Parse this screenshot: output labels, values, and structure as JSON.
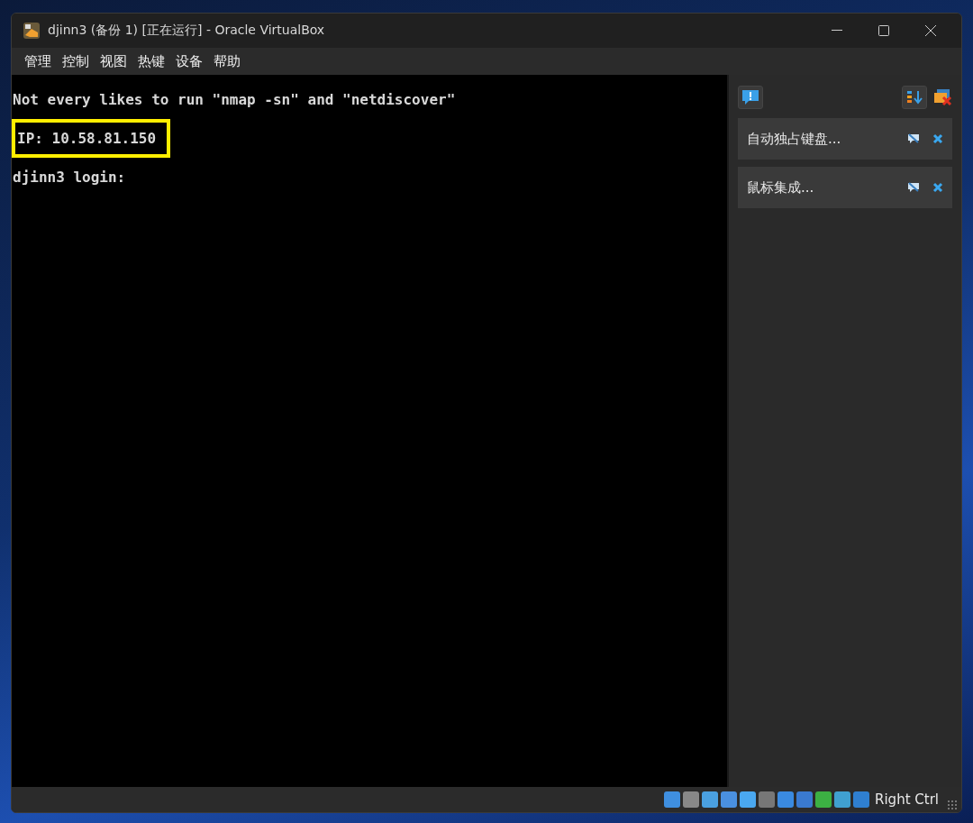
{
  "window": {
    "title": "djinn3 (备份 1) [正在运行] - Oracle VirtualBox"
  },
  "menu": [
    "管理",
    "控制",
    "视图",
    "热键",
    "设备",
    "帮助"
  ],
  "console": [
    {
      "text": "Not every likes to run \"nmap -sn\" and \"netdiscover\"",
      "highlighted": false
    },
    {
      "text": "IP: 10.58.81.150",
      "highlighted": true
    },
    {
      "text": "djinn3 login:",
      "highlighted": false
    }
  ],
  "notifications": [
    {
      "label": "自动独占键盘..."
    },
    {
      "label": "鼠标集成..."
    }
  ],
  "status_bar": {
    "host_key": "Right Ctrl"
  }
}
